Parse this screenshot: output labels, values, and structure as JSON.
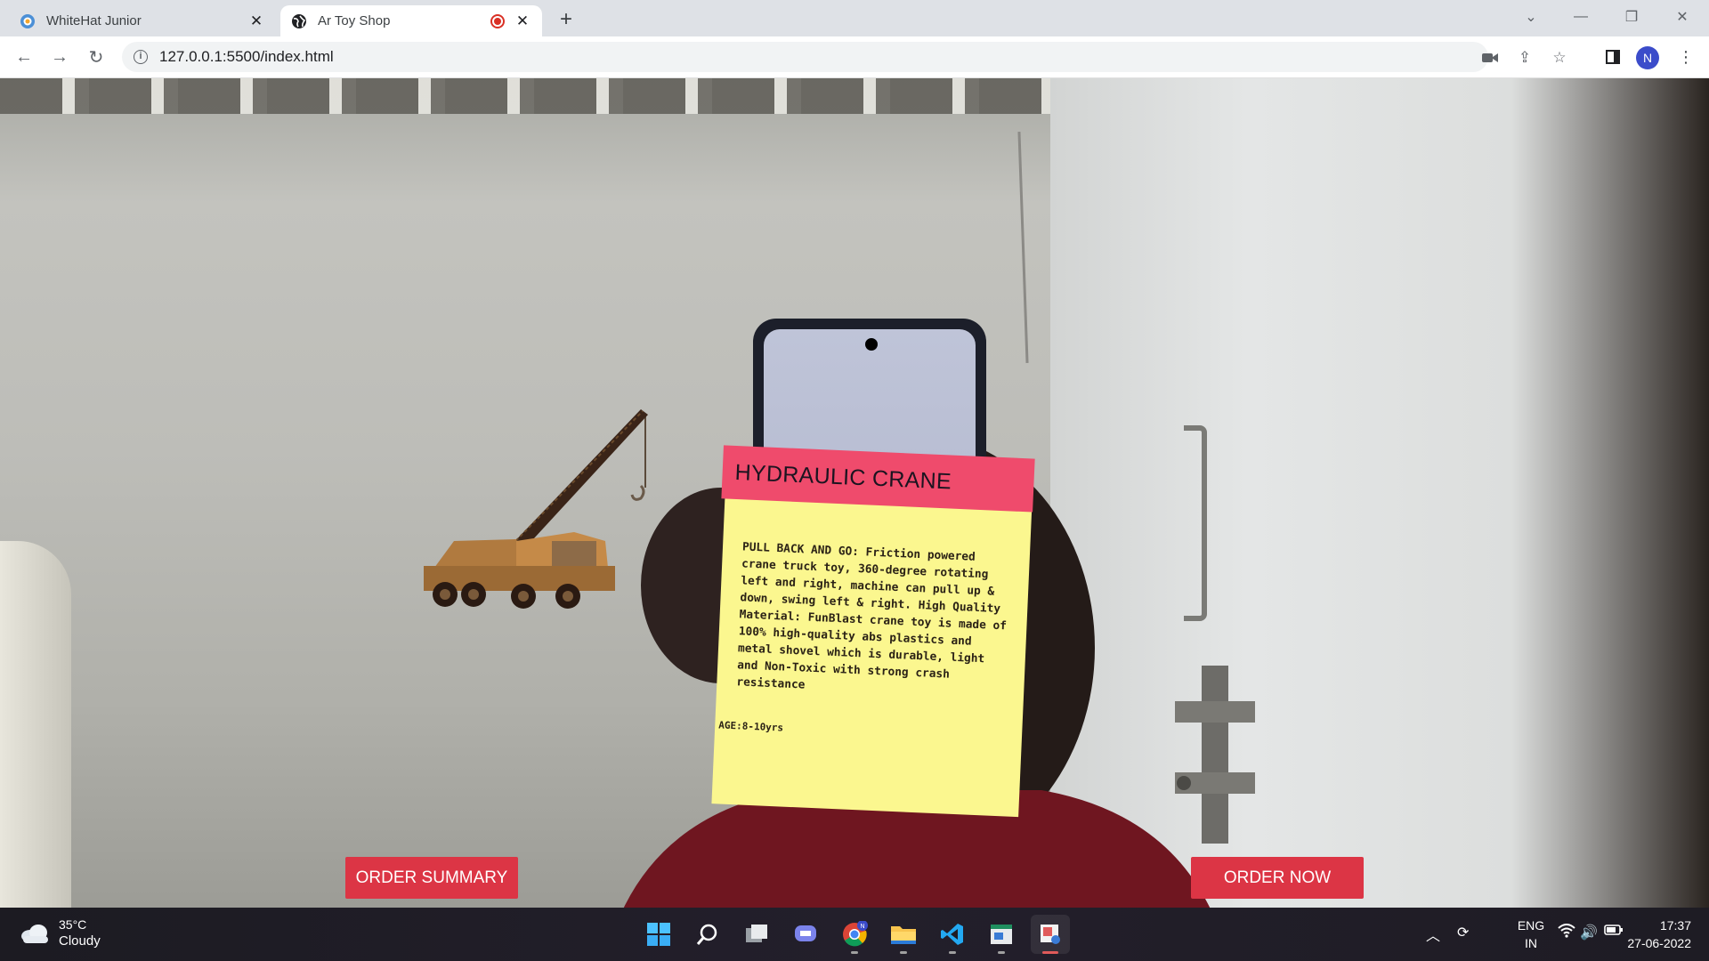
{
  "browser": {
    "tabs": [
      {
        "title": "WhiteHat Junior",
        "active": false,
        "icon": "whitehat-icon"
      },
      {
        "title": "Ar Toy Shop",
        "active": true,
        "icon": "globe-icon",
        "recording": true
      }
    ],
    "url": "127.0.0.1:5500/index.html",
    "profile_initial": "N"
  },
  "page": {
    "toy": {
      "name": "HYDRAULIC CRANE",
      "description": "PULL BACK AND GO: Friction powered crane truck toy, 360-degree rotating left and right, machine can pull up & down, swing left & right. High Quality Material: FunBlast crane toy is made of 100% high-quality abs plastics and metal shovel which is durable, light and Non-Toxic with strong crash resistance",
      "age": "AGE:8-10yrs"
    },
    "buttons": {
      "order_summary": "ORDER SUMMARY",
      "order_now": "ORDER NOW"
    },
    "colors": {
      "card_header": "#ef4b6c",
      "card_body": "#fbf78f",
      "button": "#dc3545"
    }
  },
  "taskbar": {
    "weather_temp": "35°C",
    "weather_cond": "Cloudy",
    "lang_line1": "ENG",
    "lang_line2": "IN",
    "time": "17:37",
    "date": "27-06-2022",
    "apps": [
      "start-icon",
      "search-icon",
      "task-view-icon",
      "teams-chat-icon",
      "chrome-icon",
      "file-explorer-icon",
      "vscode-icon",
      "notepad-icon",
      "snipping-tool-icon"
    ]
  }
}
